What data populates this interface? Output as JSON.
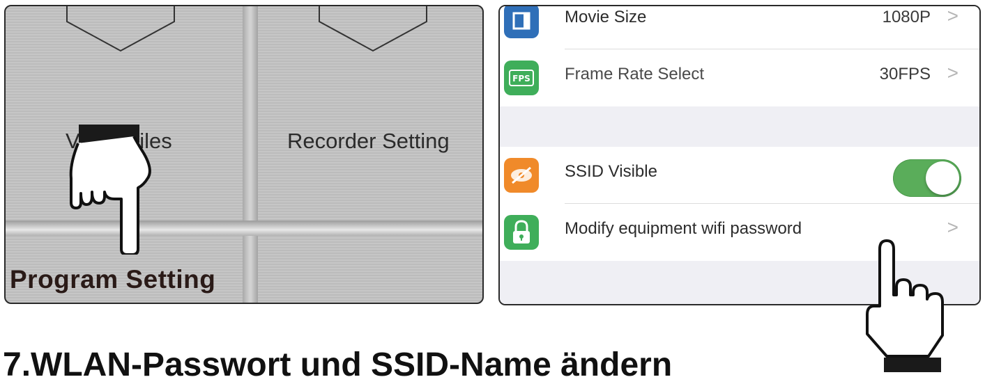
{
  "left_panel": {
    "tiles": [
      {
        "label": "Video Files"
      },
      {
        "label": "Recorder Setting"
      }
    ],
    "callout": "Program Setting"
  },
  "right_panel": {
    "rows": [
      {
        "label": "Movie Size",
        "value": "1080P",
        "icon": "movie-size-icon",
        "icon_color": "#2f6fb8"
      },
      {
        "label": "Frame Rate Select",
        "value": "30FPS",
        "icon": "fps-icon",
        "icon_text": "FPS",
        "icon_color": "#3fae5a"
      },
      {
        "label": "SSID Visible",
        "toggle": "on",
        "icon": "eye-off-icon",
        "icon_color": "#f08a2a"
      },
      {
        "label": "Modify equipment wifi password",
        "icon": "lock-icon",
        "icon_color": "#3fae5a"
      }
    ],
    "chevron": ">"
  },
  "heading": "7.WLAN-Passwort und SSID-Name ändern",
  "colors": {
    "toggle_on": "#5aad5a",
    "group_bg": "#efeff4"
  }
}
